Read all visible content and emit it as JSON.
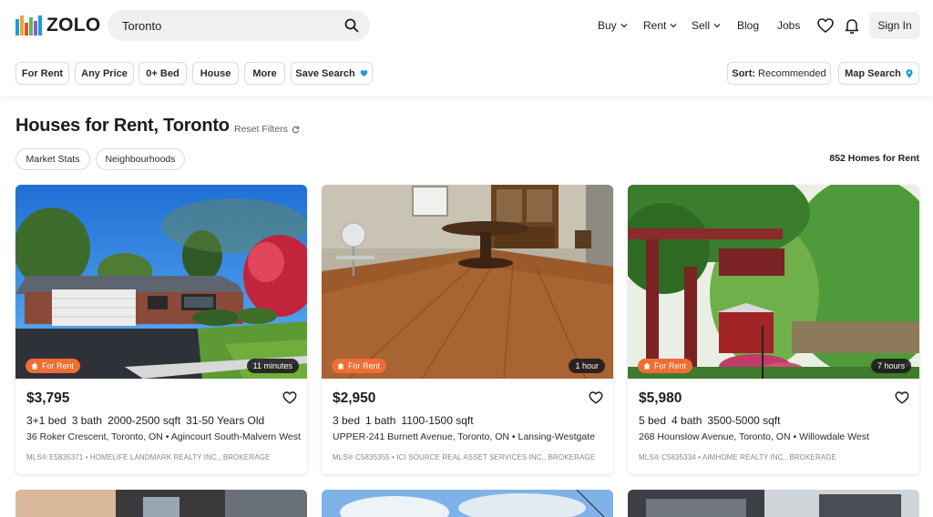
{
  "brand": {
    "name": "ZOLO",
    "bar_colors": [
      "#1a9cd8",
      "#f2a42a",
      "#e94e3d",
      "#5cb85c",
      "#8e5ad6",
      "#1a9cd8"
    ]
  },
  "search": {
    "value": "Toronto"
  },
  "nav": {
    "buy": "Buy",
    "rent": "Rent",
    "sell": "Sell",
    "blog": "Blog",
    "jobs": "Jobs",
    "sign_in": "Sign In"
  },
  "filters": {
    "for_rent": "For Rent",
    "price": "Any Price",
    "beds": "0+ Bed",
    "type": "House",
    "more": "More",
    "save_search": "Save Search",
    "sort_prefix": "Sort:",
    "sort_value": "Recommended",
    "map_search": "Map Search"
  },
  "page": {
    "title": "Houses for Rent, Toronto",
    "reset_filters": "Reset Filters",
    "market_stats": "Market Stats",
    "neighbourhoods": "Neighbourhoods",
    "count": "852 Homes for Rent"
  },
  "colors": {
    "accent_orange": "#f06d33",
    "heart_blue": "#1a9cd8"
  },
  "listings": [
    {
      "badge": "For Rent",
      "time": "11 minutes",
      "price": "$3,795",
      "beds": "3+1 bed",
      "baths": "3 bath",
      "sqft": "2000-2500 sqft",
      "age": "31-50 Years Old",
      "address": "36 Roker Crescent, Toronto, ON • Agincourt South-Malvern West",
      "mls": "MLS® E5835371 • HOMELIFE LANDMARK REALTY INC., BROKERAGE"
    },
    {
      "badge": "For Rent",
      "time": "1 hour",
      "price": "$2,950",
      "beds": "3 bed",
      "baths": "1 bath",
      "sqft": "1100-1500 sqft",
      "age": "",
      "address": "UPPER-241 Burnett Avenue, Toronto, ON • Lansing-Westgate",
      "mls": "MLS® C5835355 • ICI SOURCE REAL ASSET SERVICES INC., BROKERAGE"
    },
    {
      "badge": "For Rent",
      "time": "7 hours",
      "price": "$5,980",
      "beds": "5 bed",
      "baths": "4 bath",
      "sqft": "3500-5000 sqft",
      "age": "",
      "address": "268 Hounslow Avenue, Toronto, ON • Willowdale West",
      "mls": "MLS® C5835334 • AIMHOME REALTY INC., BROKERAGE"
    }
  ]
}
